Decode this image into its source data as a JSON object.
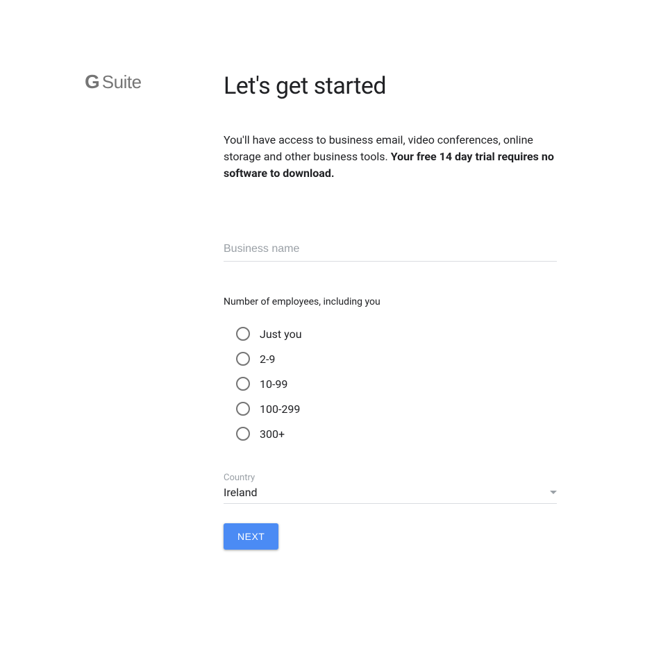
{
  "logo": {
    "g": "G",
    "suite": "Suite"
  },
  "title": "Let's get started",
  "lead_plain": "You'll have access to business email, video conferences, online storage and other business tools. ",
  "lead_bold": "Your free 14 day trial requires no software to download.",
  "business_name": {
    "placeholder": "Business name",
    "value": ""
  },
  "employees": {
    "label": "Number of employees, including you",
    "options": [
      "Just you",
      "2-9",
      "10-99",
      "100-299",
      "300+"
    ]
  },
  "country": {
    "label": "Country",
    "value": "Ireland"
  },
  "next_label": "NEXT"
}
